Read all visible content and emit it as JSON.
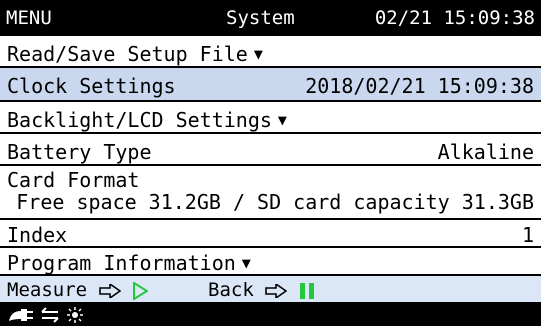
{
  "header": {
    "menu": "MENU",
    "mode": "System",
    "datetime": "02/21 15:09:38"
  },
  "rows": [
    {
      "label": "Read/Save Setup File"
    },
    {
      "label": "Clock Settings",
      "value": "2018/02/21 15:09:38"
    },
    {
      "label": "Backlight/LCD Settings"
    },
    {
      "label": "Battery Type",
      "value": "Alkaline"
    },
    {
      "label": "Card Format",
      "sub": "Free space 31.2GB / SD card capacity 31.3GB"
    },
    {
      "label": "Index",
      "value": "1"
    },
    {
      "label": "Program Information"
    }
  ],
  "footer": {
    "measure_label": "Measure",
    "back_label": "Back"
  },
  "status_icons": [
    "power-plug-icon",
    "swap-arrows-icon",
    "brightness-sun-icon"
  ],
  "colors": {
    "selected_row": "#c9d7ef",
    "footer_bg": "#dbe7f7",
    "play_green": "#22c83a",
    "pause_green": "#22c83a"
  }
}
